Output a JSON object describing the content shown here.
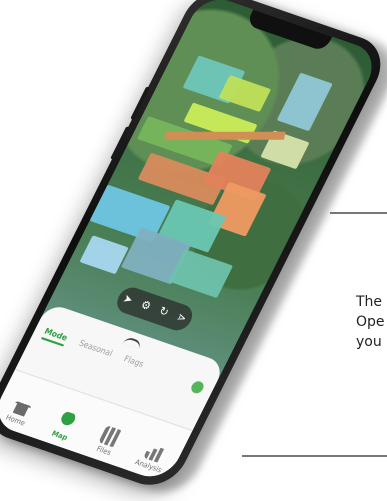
{
  "callout": {
    "lines": [
      "The",
      "Ope",
      "you"
    ]
  },
  "map_controls": {
    "icons": [
      "locate-arrow-icon",
      "settings-gear-icon",
      "refresh-icon",
      "layers-icon"
    ]
  },
  "drawer": {
    "tabs": [
      {
        "label": "Mode"
      },
      {
        "label": "Seasonal"
      },
      {
        "label": "Flags"
      }
    ]
  },
  "bottom_nav": {
    "items": [
      {
        "label": "Home",
        "icon": "home-icon"
      },
      {
        "label": "Map",
        "icon": "user-icon"
      },
      {
        "label": "Files",
        "icon": "files-icon"
      },
      {
        "label": "Analysis",
        "icon": "chart-icon"
      }
    ]
  }
}
